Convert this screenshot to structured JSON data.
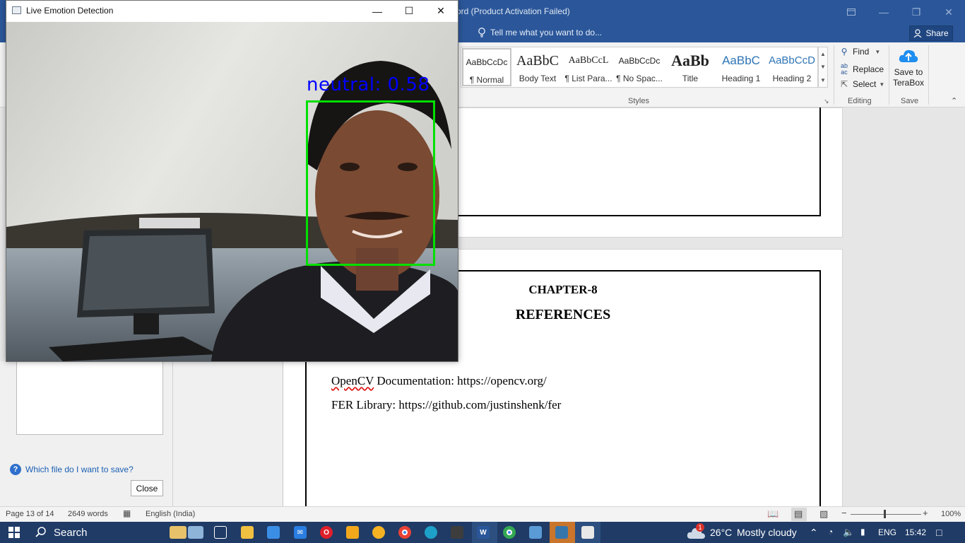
{
  "word": {
    "title": "ord (Product Activation Failed)",
    "tell_me": "Tell me what you want to do...",
    "share": "Share",
    "styles": [
      {
        "sample": "AaBbCcDc",
        "label": "¶ Normal"
      },
      {
        "sample": "AaBbC",
        "label": "Body Text"
      },
      {
        "sample": "AaBbCcL",
        "label": "¶ List Para..."
      },
      {
        "sample": "AaBbCcDc",
        "label": "¶ No Spac..."
      },
      {
        "sample": "AaBb",
        "label": "Title"
      },
      {
        "sample": "AaBbC",
        "label": "Heading 1"
      },
      {
        "sample": "AaBbCcD",
        "label": "Heading 2"
      }
    ],
    "groups": {
      "styles": "Styles",
      "editing": "Editing",
      "save": "Save"
    },
    "editing": {
      "find": "Find",
      "replace": "Replace",
      "select": "Select"
    },
    "save_to": "Save to",
    "terabox": "TeraBox",
    "document": {
      "chapter": "CHAPTER-8",
      "heading": "REFERENCES",
      "ref1_prefix": "OpenCV",
      "ref1_rest": " Documentation: https://opencv.org/",
      "ref2": "FER Library: https://github.com/justinshenk/fer"
    },
    "left_pane": {
      "help": "Which file do I want to save?",
      "close": "Close"
    },
    "status": {
      "page": "Page 13 of 14",
      "words": "2649 words",
      "language": "English (India)",
      "zoom": "100%"
    }
  },
  "emotion_window": {
    "title": "Live Emotion Detection",
    "emotion": "neutral",
    "confidence": "0.58",
    "label": "neutral: 0.58",
    "box_color": "#00e000",
    "label_color": "#0000ff"
  },
  "taskbar": {
    "search": "Search",
    "weather_temp": "26°C",
    "weather_desc": "Mostly cloudy",
    "lang": "ENG",
    "time": "15:42",
    "weather_badge": "1"
  }
}
